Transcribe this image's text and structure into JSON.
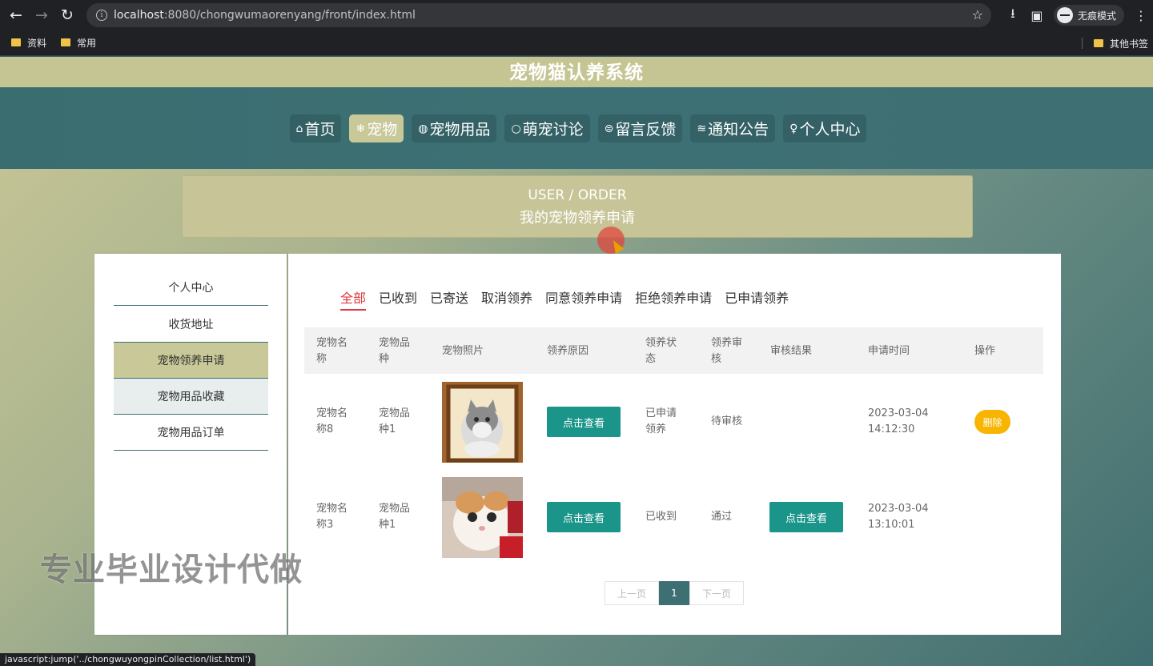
{
  "browser": {
    "url_host": "localhost",
    "url_rest": ":8080/chongwumaorenyang/front/index.html",
    "incognito_label": "无痕模式",
    "bookmarks": [
      "资料",
      "常用"
    ],
    "other_bookmarks": "其他书签",
    "status_url": "javascript:jump('../chongwuyongpinCollection/list.html')"
  },
  "site": {
    "title": "宠物猫认养系统"
  },
  "nav": {
    "items": [
      {
        "icon": "⌂",
        "label": "首页"
      },
      {
        "icon": "❄",
        "label": "宠物"
      },
      {
        "icon": "◍",
        "label": "宠物用品"
      },
      {
        "icon": "○",
        "label": "萌宠讨论"
      },
      {
        "icon": "⊜",
        "label": "留言反馈"
      },
      {
        "icon": "≋",
        "label": "通知公告"
      },
      {
        "icon": "♀",
        "label": "个人中心"
      }
    ]
  },
  "banner": {
    "en": "USER / ORDER",
    "zh": "我的宠物领养申请"
  },
  "sidebar": {
    "items": [
      "个人中心",
      "收货地址",
      "宠物领养申请",
      "宠物用品收藏",
      "宠物用品订单"
    ]
  },
  "tabs": [
    "全部",
    "已收到",
    "已寄送",
    "取消领养",
    "同意领养申请",
    "拒绝领养申请",
    "已申请领养"
  ],
  "table": {
    "headers": [
      "宠物名\n称",
      "宠物品\n种",
      "宠物照片",
      "领养原因",
      "领养状\n态",
      "领养审\n核",
      "审核结果",
      "申请时间",
      "操作"
    ],
    "rows": [
      {
        "name": "宠物名\n称8",
        "breed": "宠物品\n种1",
        "reason_btn": "点击查看",
        "status": "已申请\n领养",
        "review": "待审核",
        "result_btn": "",
        "time": "2023-03-04\n14:12:30",
        "action": "删除"
      },
      {
        "name": "宠物名\n称3",
        "breed": "宠物品\n种1",
        "reason_btn": "点击查看",
        "status": "已收到",
        "review": "通过",
        "result_btn": "点击查看",
        "time": "2023-03-04\n13:10:01",
        "action": ""
      }
    ]
  },
  "pager": {
    "prev": "上一页",
    "current": "1",
    "next": "下一页"
  },
  "watermark": "专业毕业设计代做",
  "colors": {
    "teal": "#1b958a",
    "khaki": "#c8c898",
    "nav_bg": "#3e6f73",
    "active_tab": "#e0383e",
    "delete": "#f7b500"
  }
}
